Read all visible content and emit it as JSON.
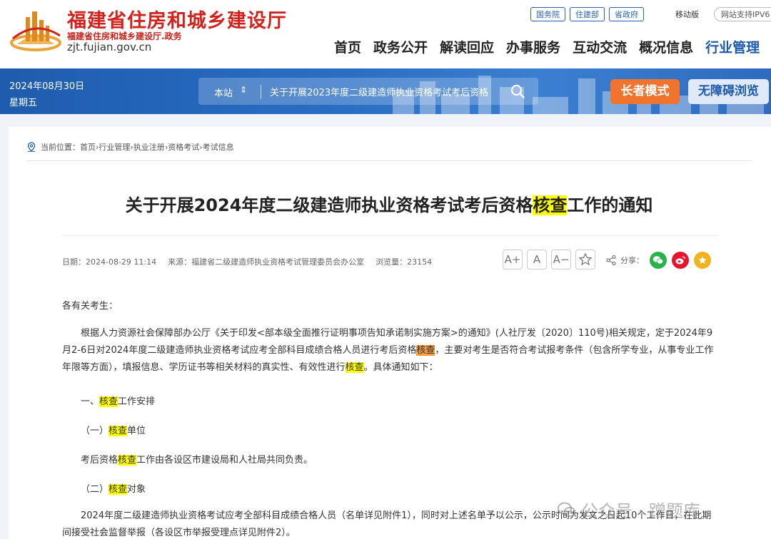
{
  "header": {
    "site_title": "福建省住房和城乡建设厅",
    "site_subtitle": "福建省住房和城乡建设厅.政务",
    "site_domain": "zjt.fujian.gov.cn",
    "top_links": [
      "国务院",
      "住建部",
      "省政府"
    ],
    "mobile": "移动版",
    "ipv6": "网站支持IPV6",
    "nav": [
      "首页",
      "政务公开",
      "解读回应",
      "办事服务",
      "互动交流",
      "概况信息",
      "行业管理"
    ],
    "nav_active_index": 6
  },
  "banner": {
    "date": "2024年08月30日",
    "weekday": "星期五",
    "scope": "本站",
    "scope_arrow": "⇕",
    "search_value": "关于开展2023年度二级建造师执业资格考试考后资格",
    "elder_mode": "长者模式",
    "accessible": "无障碍浏览"
  },
  "breadcrumb": {
    "label": "当前位置：",
    "items": [
      "首页",
      "行业管理",
      "执业注册",
      "资格考试",
      "考试信息"
    ],
    "separator": " › "
  },
  "article": {
    "title_pre": "关于开展2024年度二级建造师执业资格考试考后资格",
    "title_hl": "核查",
    "title_post": "工作的通知",
    "date": "日期：2024-08-29 11:14",
    "source": "来源：福建省二级建造师执业资格考试管理委员会办公室",
    "views": "浏览量：23154",
    "font_larger": "A+",
    "font_normal": "A",
    "font_smaller": "A−",
    "share_label": "分享：",
    "salutation": "各有关考生：",
    "p1_a": "根据人力资源社会保障部办公厅《关于印发<部本级全面推行证明事项告知承诺制实施方案>的通知》(人社厅发〔2020〕110号)相关规定，定于2024年9月2-6日对2024年度二级建造师执业资格考试应考全部科目成绩合格人员进行考后资格",
    "p1_hl": "核查",
    "p1_b": "，主要对考生是否符合考试报考条件（包含所学专业，从事专业工作年限等方面），填报信息、学历证书等相关材料的真实性、有效性进行",
    "p1_hl2": "核查",
    "p1_c": "。具体通知如下：",
    "s1_pre": "一、",
    "s1_hl": "核查",
    "s1_post": "工作安排",
    "s2_pre": "（一）",
    "s2_hl": "核查",
    "s2_post": "单位",
    "p2_pre": "考后资格",
    "p2_hl": "核查",
    "p2_post": "工作由各设区市建设局和人社局共同负责。",
    "s3_pre": "（二）",
    "s3_hl": "核查",
    "s3_post": "对象",
    "p3": "2024年度二级建造师执业资格考试应考全部科目成绩合格人员（名单详见附件1），同时对上述名单予以公示，公示时间为发文之日起10个工作日，在此期间接受社会监督举报（各设区市举报受理点详见附件2）。"
  },
  "watermark": "公众号 · 蹭题库",
  "colors": {
    "brand_red": "#d1231d",
    "nav_blue": "#1d5aab",
    "elder_orange": "#f0732e",
    "highlight": "#ffff00"
  }
}
